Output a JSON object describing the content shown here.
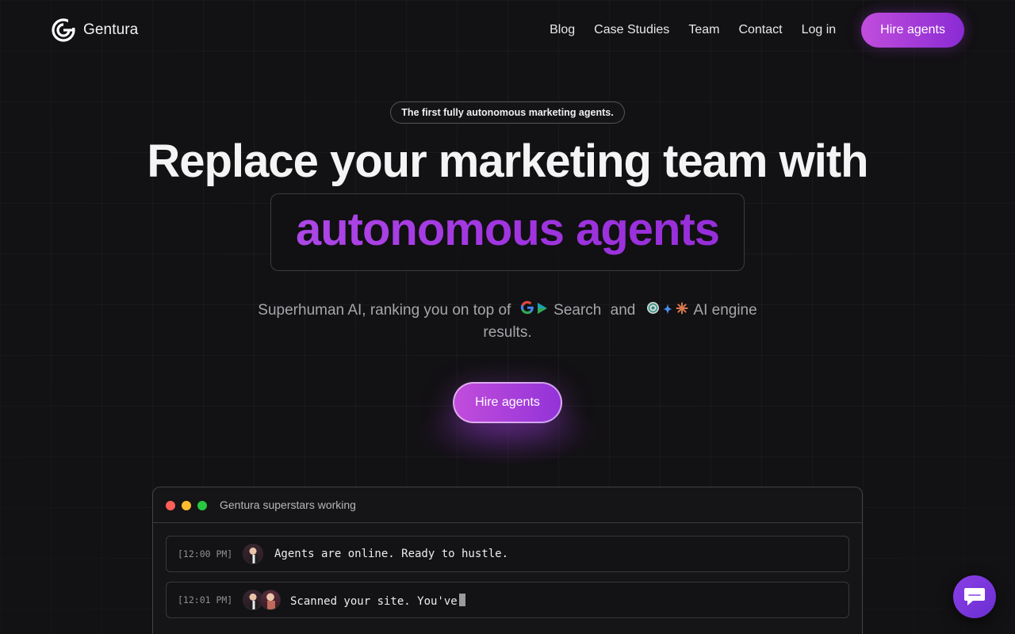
{
  "brand": {
    "name": "Gentura",
    "logo_icon": "gentura-g-logo-icon"
  },
  "nav": {
    "links": [
      "Blog",
      "Case Studies",
      "Team",
      "Contact",
      "Log in"
    ],
    "cta_label": "Hire agents"
  },
  "hero": {
    "pill_text": "The first fully autonomous marketing agents.",
    "headline": "Replace your marketing team with",
    "highlight": "autonomous agents",
    "sub_prefix": "Superhuman AI, ranking you on top of",
    "sub_search": "Search",
    "sub_and": "and",
    "sub_ai": "AI engine",
    "sub_suffix": "results.",
    "cta_label": "Hire agents",
    "icons": [
      "google-icon",
      "google-ads-icon",
      "openai-icon",
      "gemini-icon",
      "claude-icon"
    ]
  },
  "terminal": {
    "title": "Gentura superstars working",
    "rows": [
      {
        "time": "[12:00 PM]",
        "message": "Agents are online. Ready to hustle."
      },
      {
        "time": "[12:01 PM]",
        "message": "Scanned your site. You've"
      }
    ]
  },
  "chat": {
    "icon": "chat-bubble-icon"
  },
  "colors": {
    "accent_start": "#c14ddc",
    "accent_end": "#8a2bd4",
    "background": "#121113"
  }
}
